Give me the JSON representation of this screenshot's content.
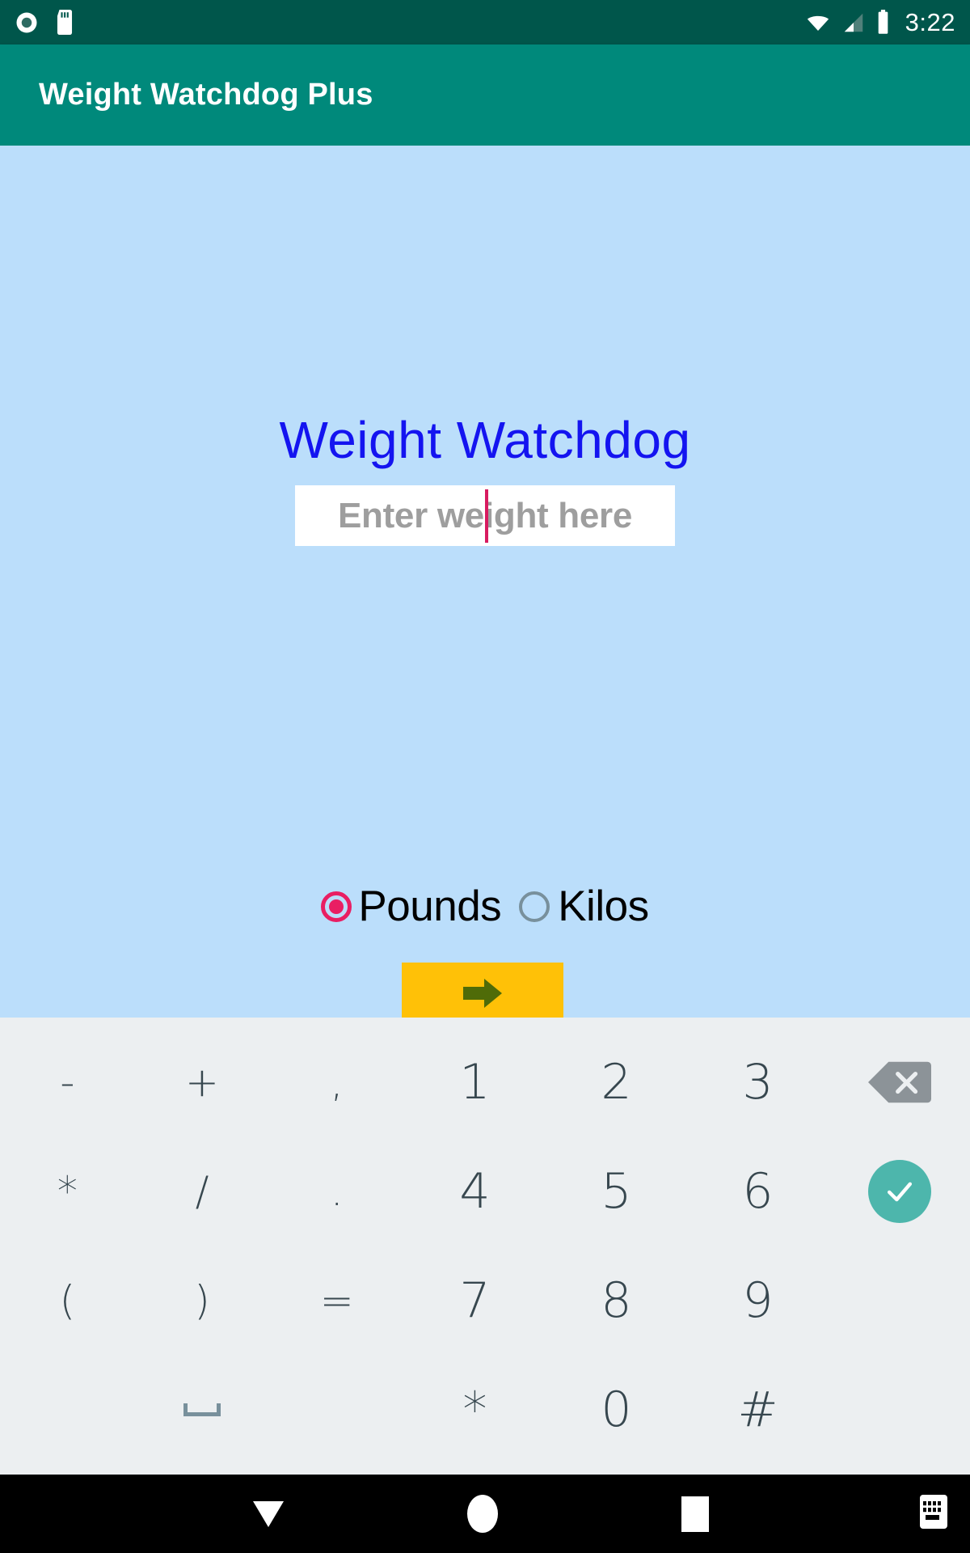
{
  "status_bar": {
    "icons_left": [
      "record-circle-icon",
      "sd-card-icon"
    ],
    "icons_right": [
      "wifi-icon",
      "cellular-signal-icon",
      "battery-icon"
    ],
    "clock": "3:22",
    "background_color": "#00564B"
  },
  "app_bar": {
    "title": "Weight Watchdog Plus",
    "background_color": "#00897B",
    "text_color": "#FFFFFF"
  },
  "content": {
    "background_color": "#BBDEFB",
    "headline": "Weight Watchdog",
    "headline_color": "#1414F0",
    "weight_input": {
      "placeholder": "Enter weight here",
      "value": "",
      "cursor_color": "#D81B60",
      "field_background": "#FFFFFF"
    },
    "units": {
      "selected": "Pounds",
      "accent_color": "#E91E63",
      "options": [
        {
          "label": "Pounds",
          "checked": true
        },
        {
          "label": "Kilos",
          "checked": false
        }
      ]
    },
    "submit_button": {
      "icon": "arrow-right-icon",
      "background_color": "#FFC107",
      "icon_color": "#4F6B08"
    }
  },
  "keyboard": {
    "background_color": "#ECEFF1",
    "key_text_color": "#37474F",
    "rows": [
      {
        "symbols": [
          "-",
          "+",
          ","
        ],
        "numbers": [
          "1",
          "2",
          "3"
        ],
        "action": {
          "name": "backspace-key",
          "icon": "backspace-icon",
          "color": "#8C9398"
        }
      },
      {
        "symbols": [
          "*",
          "/",
          "."
        ],
        "numbers": [
          "4",
          "5",
          "6"
        ],
        "action": {
          "name": "enter-key",
          "icon": "checkmark-icon",
          "color": "#4DB6AC"
        }
      },
      {
        "symbols": [
          "(",
          ")",
          "="
        ],
        "numbers": [
          "7",
          "8",
          "9"
        ],
        "action": null
      },
      {
        "symbols": [
          "",
          "space",
          ""
        ],
        "numbers": [
          "*",
          "0",
          "#"
        ],
        "action": null
      }
    ]
  },
  "nav_bar": {
    "background_color": "#000000",
    "buttons": [
      {
        "name": "back-button",
        "icon": "triangle-down-icon"
      },
      {
        "name": "home-button",
        "icon": "circle-icon"
      },
      {
        "name": "recents-button",
        "icon": "square-icon"
      },
      {
        "name": "keyboard-switch-button",
        "icon": "keyboard-icon"
      }
    ]
  }
}
